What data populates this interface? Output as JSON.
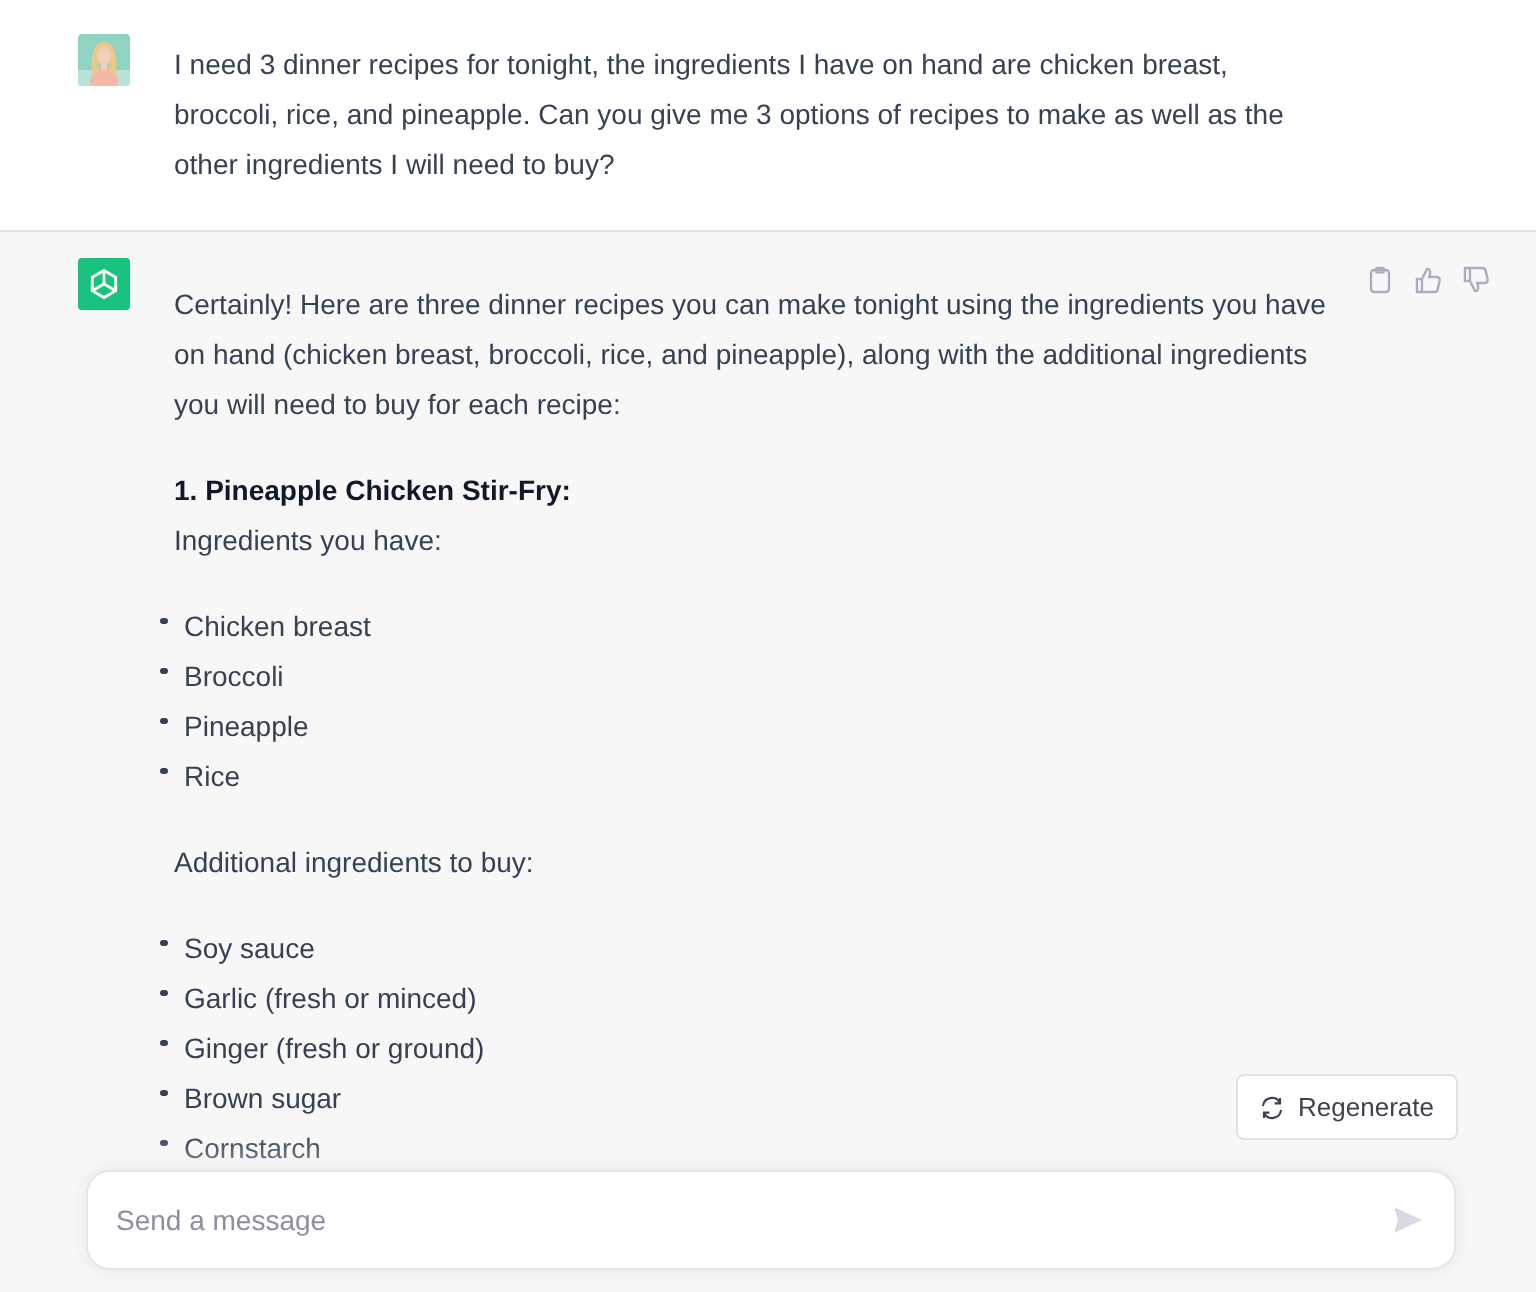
{
  "conversation": [
    {
      "kind": "user_message",
      "text": "I need 3 dinner recipes for tonight, the ingredients I have on hand are chicken breast, broccoli, rice, and pineapple. Can you give me 3 options of recipes to make as well as the other ingredients I will need to buy?"
    },
    {
      "kind": "assistant_message",
      "blocks": [
        {
          "kind": "paragraph",
          "text": "Certainly! Here are three dinner recipes you can make tonight using the ingredients you have on hand (chicken breast, broccoli, rice, and pineapple), along with the additional ingredients you will need to buy for each recipe:"
        },
        {
          "kind": "heading",
          "text": "1. Pineapple Chicken Stir-Fry:"
        },
        {
          "kind": "paragraph",
          "text": "Ingredients you have:"
        },
        {
          "kind": "list",
          "items": [
            "Chicken breast",
            "Broccoli",
            "Pineapple",
            "Rice"
          ]
        },
        {
          "kind": "paragraph",
          "text": "Additional ingredients to buy:"
        },
        {
          "kind": "list",
          "items": [
            "Soy sauce",
            "Garlic (fresh or minced)",
            "Ginger (fresh or ground)",
            "Brown sugar",
            "Cornstarch"
          ]
        }
      ]
    }
  ],
  "regenerate_button": {
    "label": "Regenerate"
  },
  "composer": {
    "placeholder": "Send a message"
  }
}
